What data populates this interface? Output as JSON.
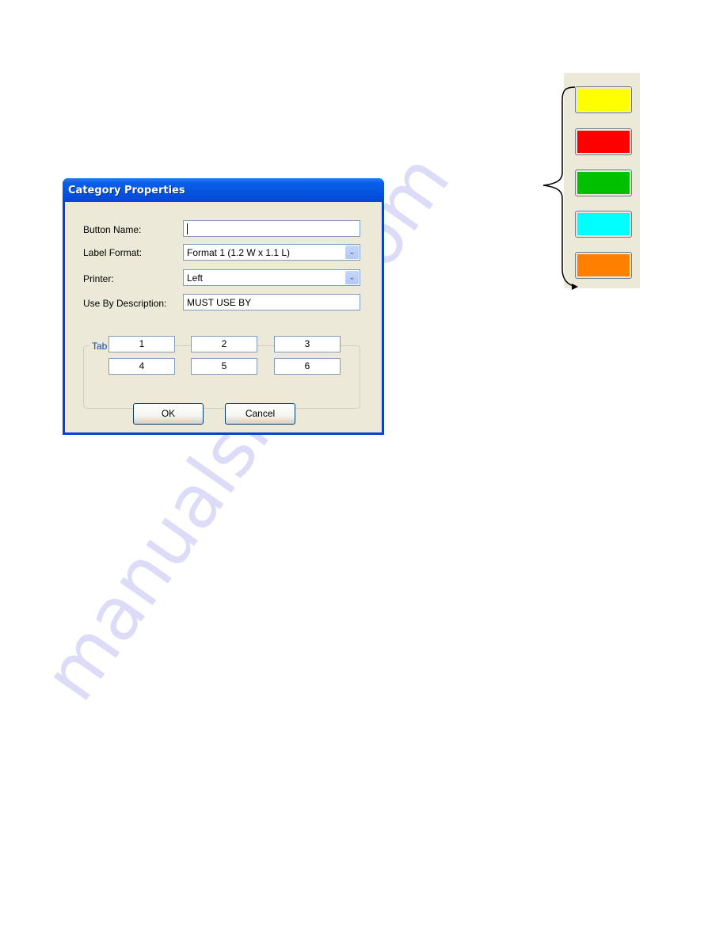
{
  "watermark": "manualshive.com",
  "dialog": {
    "title": "Category Properties",
    "fields": {
      "button_name": {
        "label": "Button Name:",
        "value": ""
      },
      "label_format": {
        "label": "Label Format:",
        "value": "Format 1 (1.2 W x 1.1 L)"
      },
      "printer": {
        "label": "Printer:",
        "value": "Left"
      },
      "use_by_description": {
        "label": "Use By Description:",
        "value": "MUST USE BY"
      }
    },
    "tab_names": {
      "title": "Tab Names",
      "tabs": [
        "1",
        "2",
        "3",
        "4",
        "5",
        "6"
      ]
    },
    "buttons": {
      "ok": "OK",
      "cancel": "Cancel"
    },
    "dropdown_icon": "chevron-down-icon"
  },
  "color_palette": {
    "swatches": [
      {
        "name": "yellow",
        "color": "#ffff00"
      },
      {
        "name": "red",
        "color": "#ff0000"
      },
      {
        "name": "green",
        "color": "#00c000"
      },
      {
        "name": "cyan",
        "color": "#00ffff"
      },
      {
        "name": "orange",
        "color": "#ff8000"
      }
    ]
  }
}
